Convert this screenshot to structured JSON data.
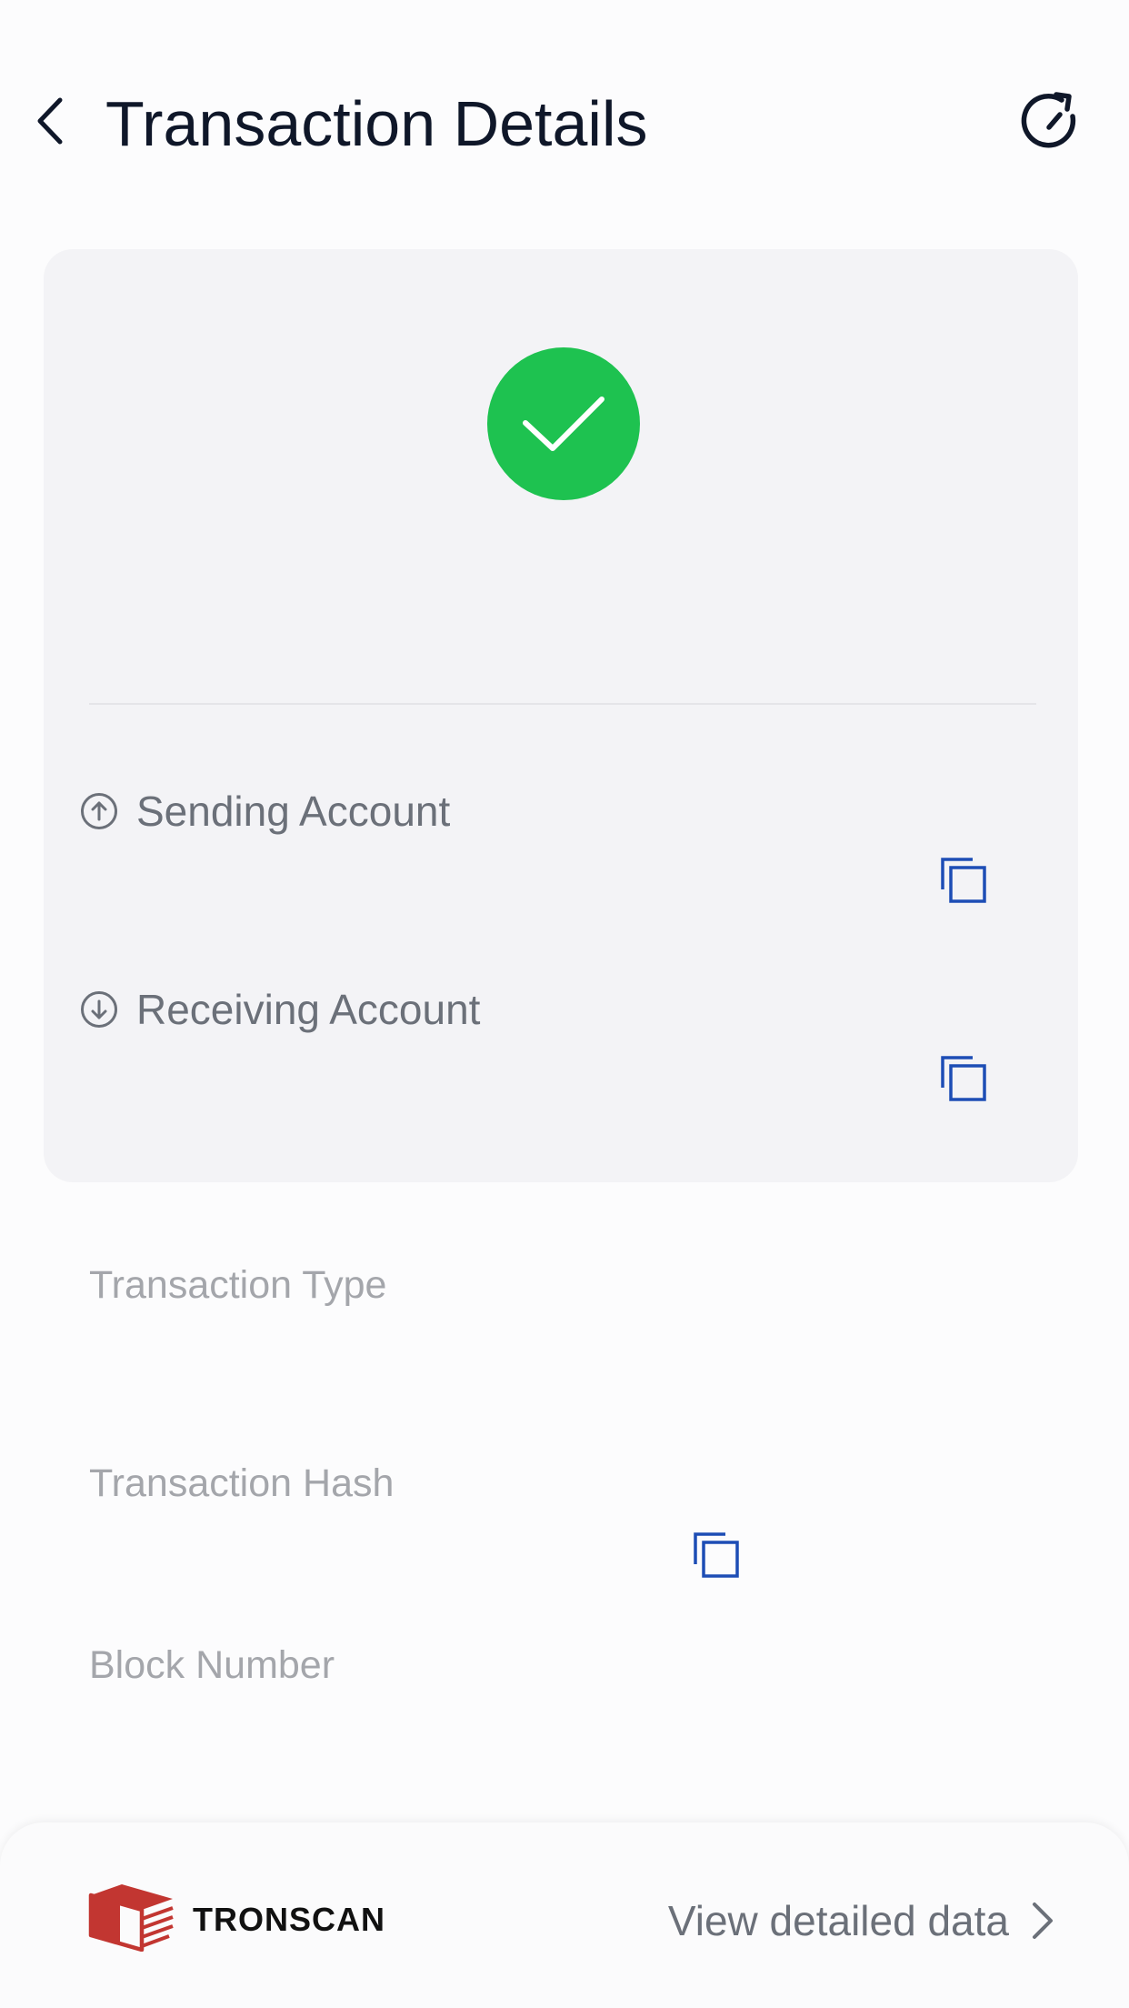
{
  "header": {
    "title": "Transaction Details",
    "back_icon": "chevron-left-icon",
    "refresh_icon": "refresh-icon"
  },
  "status": {
    "icon": "check-circle-icon",
    "color": "#1ec250"
  },
  "accounts": {
    "sending_label": "Sending Account",
    "receiving_label": "Receiving Account"
  },
  "details": {
    "transaction_type_label": "Transaction Type",
    "transaction_hash_label": "Transaction Hash",
    "block_number_label": "Block Number"
  },
  "footer": {
    "brand": "TRONSCAN",
    "brand_color": "#c23631",
    "link_label": "View detailed data"
  },
  "colors": {
    "copy_icon": "#1d4db5",
    "card_bg": "#f3f3f6"
  }
}
